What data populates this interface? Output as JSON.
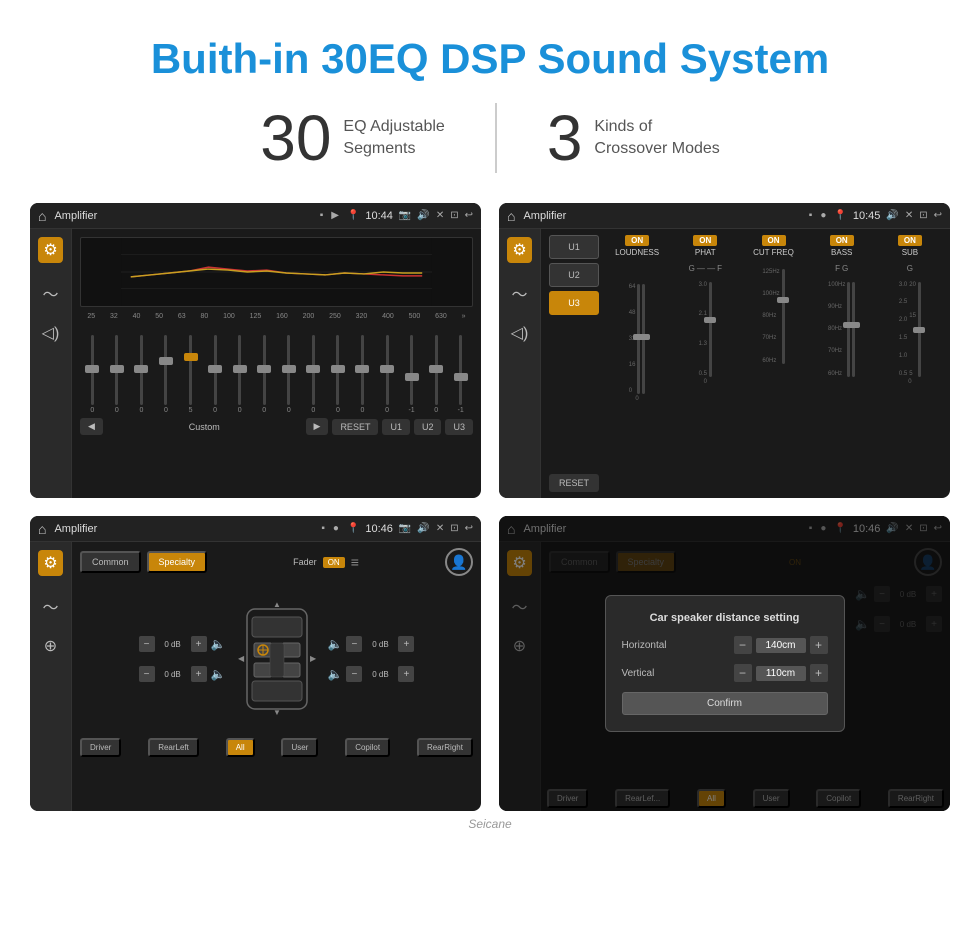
{
  "page": {
    "title": "Buith-in 30EQ DSP Sound System",
    "stat1_number": "30",
    "stat1_desc_line1": "EQ Adjustable",
    "stat1_desc_line2": "Segments",
    "stat2_number": "3",
    "stat2_desc_line1": "Kinds of",
    "stat2_desc_line2": "Crossover Modes"
  },
  "screen1": {
    "topbar_title": "Amplifier",
    "topbar_time": "10:44",
    "eq_labels": [
      "25",
      "32",
      "40",
      "50",
      "63",
      "80",
      "100",
      "125",
      "160",
      "200",
      "250",
      "320",
      "400",
      "500",
      "630"
    ],
    "eq_values": [
      "0",
      "0",
      "0",
      "0",
      "5",
      "0",
      "0",
      "0",
      "0",
      "0",
      "0",
      "0",
      "0",
      "-1",
      "0",
      "-1"
    ],
    "btn_play": "▶",
    "btn_back": "◀",
    "btn_custom": "Custom",
    "btn_reset": "RESET",
    "btn_u1": "U1",
    "btn_u2": "U2",
    "btn_u3": "U3"
  },
  "screen2": {
    "topbar_title": "Amplifier",
    "topbar_time": "10:45",
    "btn_u1": "U1",
    "btn_u2": "U2",
    "btn_u3": "U3",
    "channels": [
      "LOUDNESS",
      "PHAT",
      "CUT FREQ",
      "BASS",
      "SUB"
    ],
    "btn_reset": "RESET"
  },
  "screen3": {
    "topbar_title": "Amplifier",
    "topbar_time": "10:46",
    "btn_common": "Common",
    "btn_specialty": "Specialty",
    "fader_label": "Fader",
    "fader_on": "ON",
    "speakers": {
      "front_left_db": "0 dB",
      "front_right_db": "0 dB",
      "rear_left_db": "0 dB",
      "rear_right_db": "0 dB"
    },
    "btn_driver": "Driver",
    "btn_rear_left": "RearLeft",
    "btn_all": "All",
    "btn_user": "User",
    "btn_copilot": "Copilot",
    "btn_rear_right": "RearRight"
  },
  "screen4": {
    "topbar_title": "Amplifier",
    "topbar_time": "10:46",
    "btn_common": "Common",
    "btn_specialty": "Specialty",
    "modal_title": "Car speaker distance setting",
    "modal_horizontal_label": "Horizontal",
    "modal_horizontal_value": "140cm",
    "modal_vertical_label": "Vertical",
    "modal_vertical_value": "110cm",
    "modal_confirm": "Confirm",
    "speakers": {
      "front_right_db": "0 dB",
      "rear_right_db": "0 dB"
    },
    "btn_driver": "Driver",
    "btn_rear_left": "RearLef...",
    "btn_all": "All",
    "btn_user": "User",
    "btn_copilot": "Copilot",
    "btn_rear_right": "RearRight"
  },
  "watermark": "Seicane"
}
